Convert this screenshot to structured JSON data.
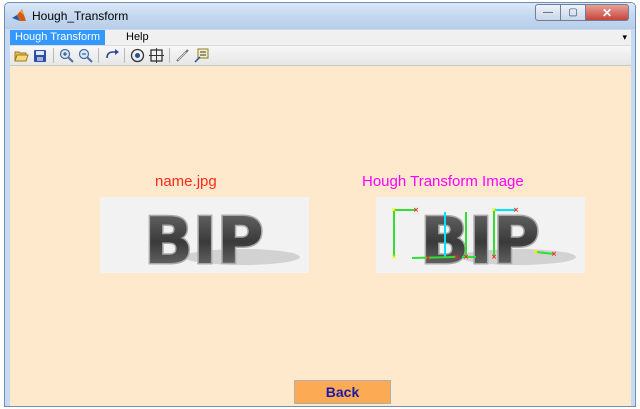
{
  "window": {
    "title": "Hough_Transform",
    "controls": {
      "minimize": "—",
      "maximize": "▢",
      "close": "✕"
    }
  },
  "menubar": {
    "items": [
      {
        "label": "Hough Transform",
        "active": true
      },
      {
        "label": "Help",
        "active": false
      }
    ],
    "overflow_glyph": "▾"
  },
  "toolbar": {
    "buttons": [
      "open-file-icon",
      "save-icon",
      "zoom-in-icon",
      "zoom-out-icon",
      "pan-icon",
      "rotate-3d-icon",
      "data-cursor-icon",
      "brush-icon",
      "insert-legend-icon"
    ]
  },
  "content": {
    "left_title": "name.jpg",
    "right_title": "Hough Transform Image",
    "left_image_text": "BIP",
    "right_image_text": "BIP",
    "back_button": "Back"
  },
  "colors": {
    "background": "#ffe9cc",
    "left_title": "#ff2a1a",
    "right_title": "#ff00ff",
    "button": "#fdaa55",
    "button_text": "#1a1aa6"
  }
}
